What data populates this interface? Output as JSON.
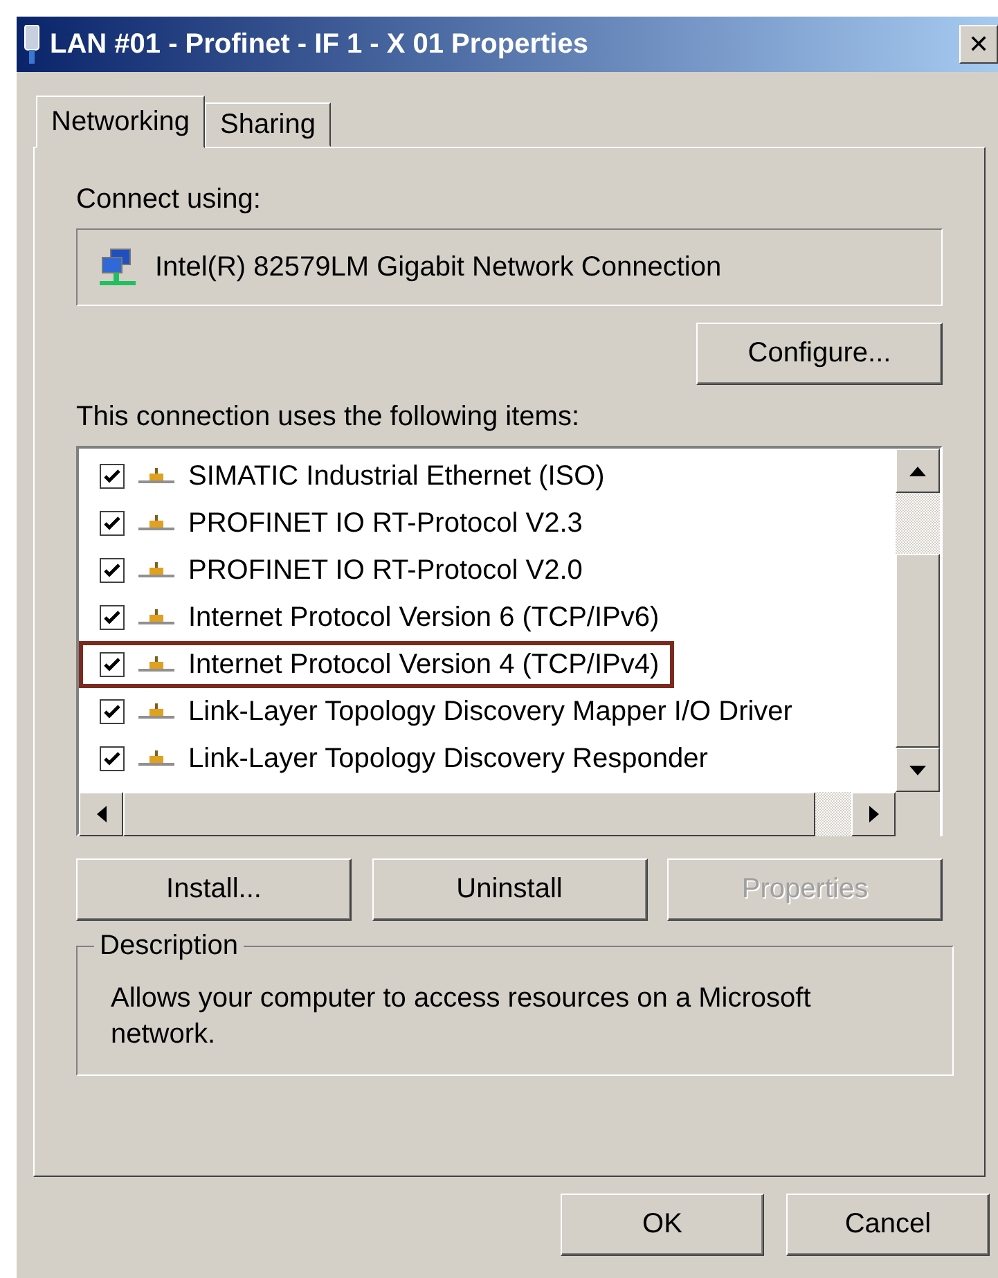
{
  "window": {
    "title": "LAN #01 - Profinet - IF 1 - X 01 Properties",
    "close": "✕"
  },
  "tabs": [
    {
      "label": "Networking",
      "selected": true
    },
    {
      "label": "Sharing",
      "selected": false
    }
  ],
  "connect_using": {
    "label": "Connect using:",
    "adapter": "Intel(R) 82579LM Gigabit Network Connection",
    "configure_button": "Configure..."
  },
  "items_label": "This connection uses the following items:",
  "items": [
    {
      "label": "SIMATIC Industrial Ethernet (ISO)",
      "checked": true,
      "highlighted": false
    },
    {
      "label": "PROFINET IO RT-Protocol V2.3",
      "checked": true,
      "highlighted": false
    },
    {
      "label": "PROFINET IO RT-Protocol V2.0",
      "checked": true,
      "highlighted": false
    },
    {
      "label": "Internet Protocol Version 6 (TCP/IPv6)",
      "checked": true,
      "highlighted": false
    },
    {
      "label": "Internet Protocol Version 4 (TCP/IPv4)",
      "checked": true,
      "highlighted": true
    },
    {
      "label": "Link-Layer Topology Discovery Mapper I/O Driver",
      "checked": true,
      "highlighted": false
    },
    {
      "label": "Link-Layer Topology Discovery Responder",
      "checked": true,
      "highlighted": false
    }
  ],
  "item_buttons": [
    {
      "label": "Install...",
      "disabled": false
    },
    {
      "label": "Uninstall",
      "disabled": false
    },
    {
      "label": "Properties",
      "disabled": true
    }
  ],
  "description": {
    "title": "Description",
    "text": "Allows your computer to access resources on a Microsoft network."
  },
  "buttons": [
    {
      "label": "OK",
      "disabled": false
    },
    {
      "label": "Cancel",
      "disabled": false
    }
  ]
}
